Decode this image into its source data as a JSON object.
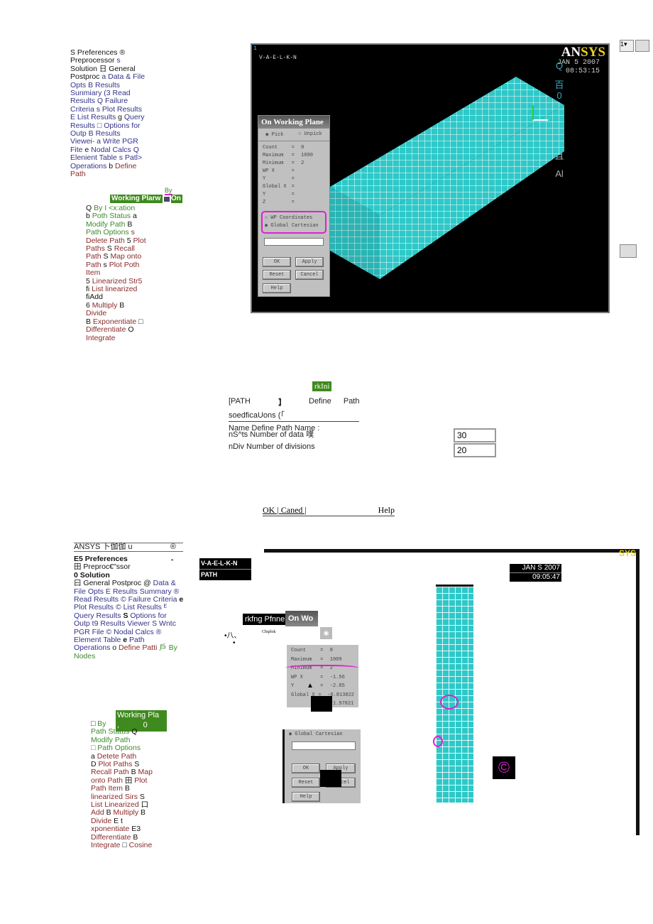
{
  "top_menu": {
    "lines": [
      [
        [
          "k",
          "S Preferences ®"
        ]
      ],
      [
        [
          "k",
          "Preprocessor "
        ],
        [
          "b",
          "s"
        ]
      ],
      [
        [
          "k",
          "Solution 日 General"
        ]
      ],
      [
        [
          "k",
          "Postproc "
        ],
        [
          "b",
          "a Data & File"
        ]
      ],
      [
        [
          "b",
          "Opts B Results"
        ]
      ],
      [
        [
          "b",
          "Sunmiary (3 Read"
        ]
      ],
      [
        [
          "b",
          "Results Q Failure"
        ]
      ],
      [
        [
          "b",
          "Criteria s Plot Results"
        ]
      ],
      [
        [
          "b",
          "E List Results "
        ],
        [
          "k",
          "g"
        ],
        [
          "b",
          " Query"
        ]
      ],
      [
        [
          "b",
          "Results □ Options for"
        ]
      ],
      [
        [
          "b",
          "Outp B Results"
        ]
      ],
      [
        [
          "b",
          "Viewei- a Write PGR"
        ]
      ],
      [
        [
          "b",
          "Fite "
        ],
        [
          "k",
          "e"
        ],
        [
          "b",
          " Nodal Calcs Q"
        ]
      ],
      [
        [
          "b",
          "Elenient Table s Patl>"
        ]
      ],
      [
        [
          "b",
          "Operations "
        ],
        [
          "k",
          "b"
        ],
        [
          "r",
          " Define"
        ]
      ],
      [
        [
          "r",
          "Path"
        ]
      ]
    ]
  },
  "top_submenu": {
    "by_label": "By",
    "working_plane": "Working Plarw",
    "on": "On",
    "lines": [
      [
        [
          "k",
          "Q "
        ],
        [
          "g",
          "By I <x:ation"
        ]
      ],
      [
        [
          "k",
          "b "
        ],
        [
          "g",
          "Poth Status "
        ],
        [
          "k",
          "a"
        ]
      ],
      [
        [
          "g",
          "Modify Path "
        ],
        [
          "k",
          "B"
        ]
      ],
      [
        [
          "g",
          "Path Options "
        ],
        [
          "r",
          "s"
        ]
      ],
      [
        [
          "r",
          "Delete Path "
        ],
        [
          "k",
          "5"
        ],
        [
          "r",
          " Plot"
        ]
      ],
      [
        [
          "r",
          "Paths "
        ],
        [
          "k",
          "S"
        ],
        [
          "r",
          " Recall"
        ]
      ],
      [
        [
          "r",
          "Path "
        ],
        [
          "k",
          "S"
        ],
        [
          "r",
          " Map onto"
        ]
      ],
      [
        [
          "r",
          "Path "
        ],
        [
          "k",
          "s"
        ],
        [
          "r",
          " Plot Poth"
        ]
      ],
      [
        [
          "r",
          "Item"
        ]
      ],
      [
        [
          "k",
          "5 "
        ],
        [
          "r",
          "Linearized Str5"
        ]
      ],
      [
        [
          "k",
          "fi "
        ],
        [
          "r",
          "List linearized"
        ]
      ],
      [
        [
          "k",
          "fiAdd"
        ]
      ],
      [
        [
          "k",
          "6 "
        ],
        [
          "r",
          "Multiply "
        ],
        [
          "k",
          "B"
        ]
      ],
      [
        [
          "r",
          "Divide"
        ]
      ],
      [
        [
          "k",
          "B "
        ],
        [
          "r",
          "Exponentiate "
        ],
        [
          "k",
          "□"
        ]
      ],
      [
        [
          "r",
          "Differentiate "
        ],
        [
          "k",
          "O"
        ]
      ],
      [
        [
          "r",
          "Integrate"
        ]
      ]
    ]
  },
  "viewport1": {
    "number": "1",
    "label": "V-A-E-L-K-N",
    "logo": "ANSYS",
    "date": "JAN  5 2007",
    "time": "08:53:15",
    "side_glyphs": [
      "Q",
      "百",
      "0",
      "O",
      "O",
      "O",
      "A",
      "且",
      "Al"
    ]
  },
  "picker1": {
    "title": "On Working Plane",
    "pick": "Pick",
    "unpick": "Unpick",
    "rows": [
      [
        "Count",
        "=",
        "0"
      ],
      [
        "Maximum",
        "=",
        "1090"
      ],
      [
        "Minimum",
        "=",
        "2"
      ],
      [
        "WP X",
        "=",
        ""
      ],
      [
        "Y",
        "=",
        ""
      ],
      [
        "Global X",
        "=",
        ""
      ],
      [
        "Y",
        "=",
        ""
      ],
      [
        "Z",
        "=",
        ""
      ]
    ],
    "wp_coordinates": "WP Coordinates",
    "global_cartesian": "Global Cartesian",
    "ok": "OK",
    "apply": "Apply",
    "reset": "Reset",
    "cancel": "Cancel",
    "help": "Help"
  },
  "toolbar_right": {
    "select_value": "1"
  },
  "path_dialog": {
    "badge": "rkIni",
    "title_left": "[PATH",
    "title_bracket": "】",
    "title_right": "Define    Path",
    "subtitle": "soedficaUons (「",
    "name_label": "Name Define Path Name :",
    "npts_label": "nS^ts Number of data 噗",
    "npts_value": "30",
    "ndiv_label": "nDiv Number of divisions",
    "ndiv_value": "20",
    "footer": "OK | Caned |",
    "help": "Help"
  },
  "bottom_menu": {
    "header": "ANSYS 卜伽伽 u",
    "header_mark": "®",
    "dash": "-",
    "lines": [
      [
        [
          "kb",
          "E5 Preferences"
        ]
      ],
      [
        [
          "k",
          "田 Preproc€\"ssor"
        ]
      ],
      [
        [
          "kb",
          "0 Solution"
        ]
      ],
      [
        [
          "k",
          "曰 General Postproc @ "
        ],
        [
          "b",
          "Data &"
        ]
      ],
      [
        [
          "b",
          "File Opts E Results Summary ®"
        ]
      ],
      [
        [
          "b",
          "Read Results © Failure Criteria "
        ],
        [
          "kb",
          "e"
        ]
      ],
      [
        [
          "b",
          "Plot Results © List Results ᴱ"
        ]
      ],
      [
        [
          "b",
          "Query Results "
        ],
        [
          "kb",
          "S"
        ],
        [
          "b",
          " Options for"
        ]
      ],
      [
        [
          "b",
          "Outp t9 Results Viewer S Wntc"
        ]
      ],
      [
        [
          "b",
          "PGR File © Nodal Calcs ®"
        ]
      ],
      [
        [
          "b",
          "Element Table "
        ],
        [
          "kb",
          "e"
        ],
        [
          "b",
          " Path"
        ]
      ],
      [
        [
          "b",
          "Operations "
        ],
        [
          "k",
          "o "
        ],
        [
          "r",
          "Define Patti "
        ],
        [
          "g",
          "戶 By"
        ]
      ],
      [
        [
          "g",
          "Nodes"
        ]
      ]
    ]
  },
  "bottom_submenu": {
    "working_plane": "Working Pla",
    "wp_row2": ",           0",
    "lines": [
      [
        [
          "k",
          "□ "
        ],
        [
          "g",
          "By"
        ]
      ],
      [
        [
          "g",
          "Path Status "
        ],
        [
          "k",
          "Q"
        ]
      ],
      [
        [
          "g",
          "Modify Path"
        ]
      ],
      [
        [
          "g",
          "□ Path Options"
        ]
      ],
      [
        [
          "k",
          "a "
        ],
        [
          "r",
          "Detete Path"
        ]
      ],
      [
        [
          "k",
          "D "
        ],
        [
          "r",
          "Plot Paths "
        ],
        [
          "k",
          "S"
        ]
      ],
      [
        [
          "r",
          "Recall Path "
        ],
        [
          "k",
          "B "
        ],
        [
          "r",
          "Map"
        ]
      ],
      [
        [
          "r",
          "onto Path "
        ],
        [
          "k",
          "田 "
        ],
        [
          "r",
          "Plot"
        ]
      ],
      [
        [
          "r",
          "Path Item "
        ],
        [
          "k",
          "B"
        ]
      ],
      [
        [
          "r",
          "linearized Sirs "
        ],
        [
          "k",
          "S"
        ]
      ],
      [
        [
          "r",
          "List Linearized "
        ],
        [
          "k",
          "口"
        ]
      ],
      [
        [
          "r",
          "Add "
        ],
        [
          "k",
          "B "
        ],
        [
          "r",
          "Multiply "
        ],
        [
          "k",
          "B"
        ]
      ],
      [
        [
          "r",
          "Divide "
        ],
        [
          "k",
          "E t"
        ]
      ],
      [
        [
          "r",
          "xponentiate "
        ],
        [
          "k",
          "E3"
        ]
      ],
      [
        [
          "r",
          "Differentiate "
        ],
        [
          "k",
          "B"
        ]
      ],
      [
        [
          "r",
          "Integrate "
        ],
        [
          "k",
          "□ "
        ],
        [
          "r",
          "Cosine"
        ]
      ]
    ]
  },
  "viewport2": {
    "label": "V-A-E-L-K-N",
    "sublabel": "PATH",
    "date": "JAN S 2007",
    "time": "09:05:47",
    "copyright_glyph": "©"
  },
  "picker2": {
    "tab_label": "rkfng Pfnne",
    "title": "On Wo",
    "bullet1": "•八、",
    "bullet2": "•",
    "pick_label": "Chiplok",
    "rows": [
      [
        "Count",
        "=",
        "8"
      ],
      [
        "Maximum",
        "=",
        "1009"
      ],
      [
        "Minimum",
        "=",
        "2"
      ],
      [
        "WP X",
        "=",
        "-1.56"
      ],
      [
        "Y",
        "=",
        "-2.85"
      ],
      [
        "Global X",
        "=",
        "-0.813822"
      ],
      [
        "",
        "",
        "-1.97821"
      ]
    ],
    "global_cartesian": "Global Cartesian",
    "ok": "OK",
    "apply": "Apply",
    "reset": "Reset",
    "cancel": "Cancel",
    "help": "Help"
  },
  "colors": {
    "mesh": "#2fc8c8",
    "highlight": "#e020d0",
    "green": "#3f8a1e",
    "ansys_yellow": "#e8d020"
  }
}
